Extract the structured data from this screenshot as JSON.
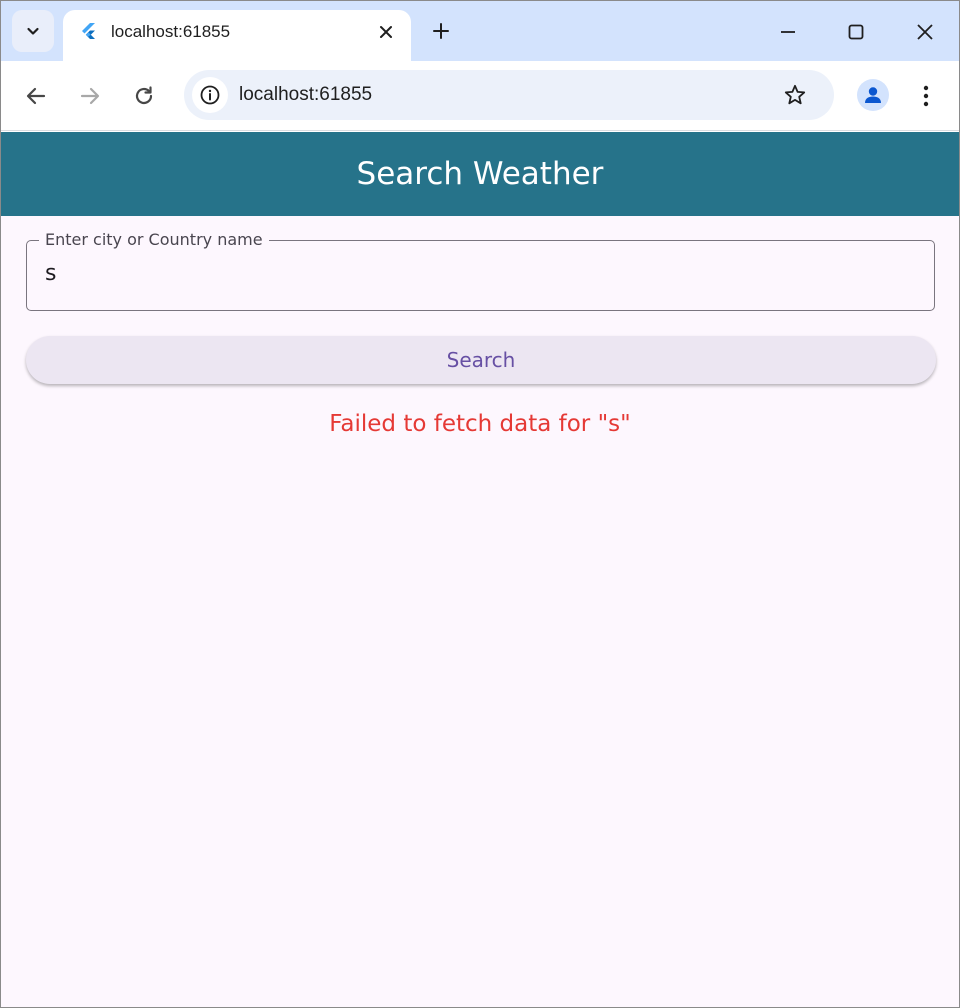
{
  "browser": {
    "tab_title": "localhost:61855",
    "url": "localhost:61855",
    "icons": {
      "tab_search": "chevron-down-icon",
      "favicon": "flutter-icon",
      "tab_close": "close-icon",
      "new_tab": "plus-icon",
      "minimize": "minimize-icon",
      "maximize": "maximize-icon",
      "close": "close-icon",
      "back": "arrow-left-icon",
      "forward": "arrow-right-icon",
      "reload": "reload-icon",
      "site_info": "info-icon",
      "bookmark": "star-icon",
      "profile": "person-icon",
      "menu": "more-vertical-icon"
    }
  },
  "app": {
    "title": "Search Weather",
    "search_field": {
      "label": "Enter city or Country name",
      "value": "s"
    },
    "search_button_label": "Search",
    "error_message": "Failed to fetch data for \"s\""
  },
  "colors": {
    "appbar": "#26738a",
    "background": "#fdf7fe",
    "error": "#e53935",
    "button_text": "#6750a4",
    "button_bg": "#ece6f2",
    "tabstrip": "#d3e3fd"
  }
}
